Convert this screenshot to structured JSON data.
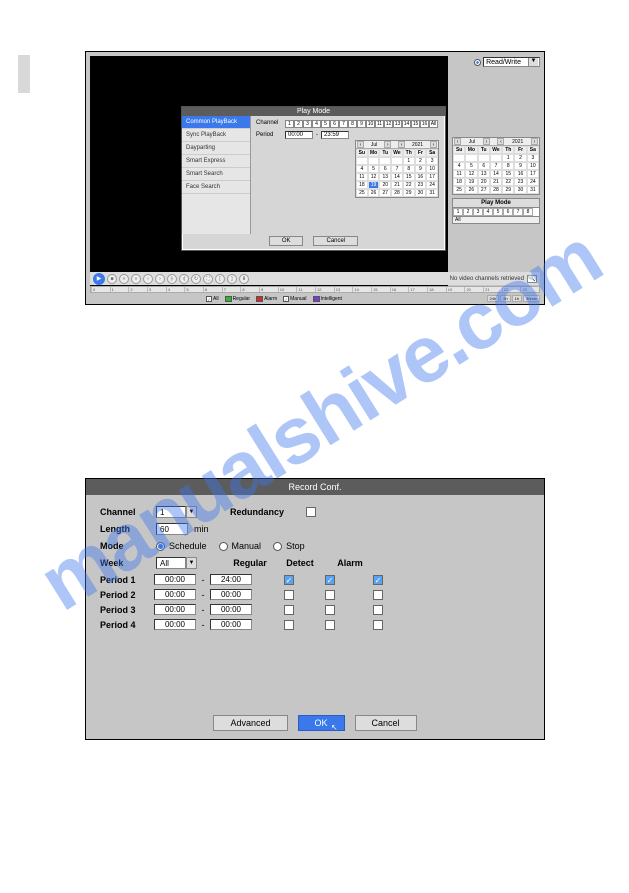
{
  "shot1": {
    "rw_label": "Read/Write",
    "modal": {
      "title": "Play Mode",
      "side_items": [
        "Common PlayBack",
        "Sync PlayBack",
        "Dayparting",
        "Smart Express",
        "Smart Search",
        "Face Search"
      ],
      "active_side": 0,
      "channel_label": "Channel",
      "channels": [
        "1",
        "2",
        "3",
        "4",
        "5",
        "6",
        "7",
        "8",
        "9",
        "10",
        "11",
        "12",
        "13",
        "14",
        "15",
        "16",
        "All"
      ],
      "period_label": "Period",
      "period_from": "00:00",
      "period_dash": "-",
      "period_to": "23:59",
      "cal": {
        "month": "Jul",
        "year": "2021",
        "dow": [
          "Su",
          "Mo",
          "Tu",
          "We",
          "Th",
          "Fr",
          "Sa"
        ],
        "days": [
          "",
          "",
          "",
          "",
          "1",
          "2",
          "3",
          "4",
          "5",
          "6",
          "7",
          "8",
          "9",
          "10",
          "11",
          "12",
          "13",
          "14",
          "15",
          "16",
          "17",
          "18",
          "19",
          "20",
          "21",
          "22",
          "23",
          "24",
          "25",
          "26",
          "27",
          "28",
          "29",
          "30",
          "31"
        ],
        "selected": "19"
      },
      "ok": "OK",
      "cancel": "Cancel"
    },
    "right_cal": {
      "month": "Jul",
      "year": "2021",
      "dow": [
        "Su",
        "Mo",
        "Tu",
        "We",
        "Th",
        "Fr",
        "Sa"
      ],
      "days": [
        "",
        "",
        "",
        "",
        "1",
        "2",
        "3",
        "4",
        "5",
        "6",
        "7",
        "8",
        "9",
        "10",
        "11",
        "12",
        "13",
        "14",
        "15",
        "16",
        "17",
        "18",
        "19",
        "20",
        "21",
        "22",
        "23",
        "24",
        "25",
        "26",
        "27",
        "28",
        "29",
        "30",
        "31"
      ]
    },
    "right_pm": {
      "title": "Play Mode",
      "chs": [
        "1",
        "2",
        "3",
        "4",
        "5",
        "6",
        "7",
        "8"
      ],
      "all": "All"
    },
    "status_text": "No video channels retrieved",
    "timeline_hours": [
      "0",
      "1",
      "2",
      "3",
      "4",
      "5",
      "6",
      "7",
      "8",
      "9",
      "10",
      "11",
      "12",
      "13",
      "14",
      "15",
      "16",
      "17",
      "18",
      "19",
      "20",
      "21",
      "22",
      "23"
    ],
    "legend": {
      "all": "All",
      "regular": "Regular",
      "alarm": "Alarm",
      "manual": "Manual",
      "intelligent": "Intelligent",
      "regular_color": "#2db82d",
      "alarm_color": "#d02b2b",
      "manual_color": "#e6c93a",
      "intelligent_color": "#7a3ad6"
    },
    "zoom": [
      "24h",
      "2h",
      "1h",
      "30min"
    ]
  },
  "shot2": {
    "title": "Record Conf.",
    "channel_label": "Channel",
    "channel_val": "1",
    "redundancy_label": "Redundancy",
    "length_label": "Length",
    "length_val": "60",
    "length_unit": "min",
    "mode_label": "Mode",
    "mode_opts": [
      "Schedule",
      "Manual",
      "Stop"
    ],
    "mode_sel": 0,
    "week_label": "Week",
    "week_val": "All",
    "cols": [
      "Regular",
      "Detect",
      "Alarm"
    ],
    "periods": [
      {
        "label": "Period 1",
        "from": "00:00",
        "to": "24:00",
        "reg": true,
        "det": true,
        "alm": true
      },
      {
        "label": "Period 2",
        "from": "00:00",
        "to": "00:00",
        "reg": false,
        "det": false,
        "alm": false
      },
      {
        "label": "Period 3",
        "from": "00:00",
        "to": "00:00",
        "reg": false,
        "det": false,
        "alm": false
      },
      {
        "label": "Period 4",
        "from": "00:00",
        "to": "00:00",
        "reg": false,
        "det": false,
        "alm": false
      }
    ],
    "advanced": "Advanced",
    "ok": "OK",
    "cancel": "Cancel"
  },
  "watermark": "manualshive.com"
}
